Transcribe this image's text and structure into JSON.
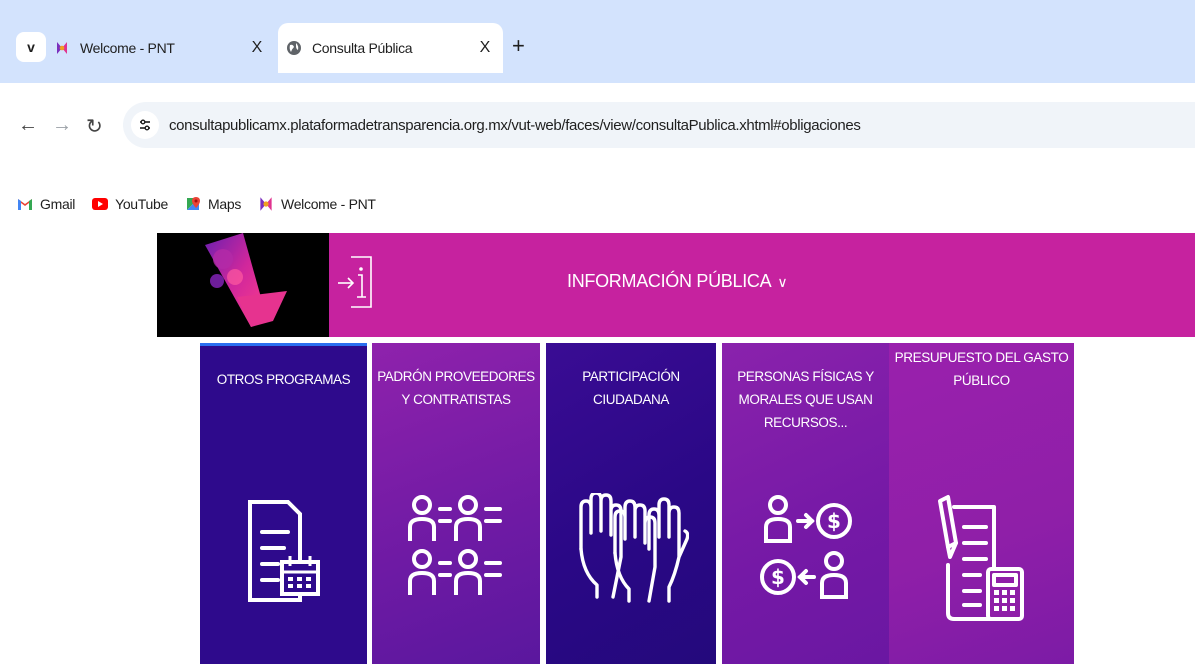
{
  "browser": {
    "tabs": [
      {
        "title": "Welcome - PNT",
        "active": false
      },
      {
        "title": "Consulta Pública",
        "active": true
      }
    ],
    "close_glyph": "X",
    "new_tab_glyph": "+",
    "menu_glyph": "v",
    "url": "consultapublicamx.plataformadetransparencia.org.mx/vut-web/faces/view/consultaPublica.xhtml#obligaciones",
    "bookmarks": [
      {
        "label": "Gmail",
        "icon": "gmail-icon"
      },
      {
        "label": "YouTube",
        "icon": "youtube-icon"
      },
      {
        "label": "Maps",
        "icon": "maps-icon"
      },
      {
        "label": "Welcome - PNT",
        "icon": "pnt-icon"
      }
    ]
  },
  "site": {
    "menu_title": "INFORMACIÓN PÚBLICA",
    "header_color": "#c6229f",
    "tiles": [
      {
        "label": "OTROS PROGRAMAS",
        "icon": "document-calendar-icon",
        "color": "#2e0a8c"
      },
      {
        "label": "PADRÓN PROVEEDORES Y CONTRATISTAS",
        "icon": "people-list-icon",
        "color": "#7a1ca8"
      },
      {
        "label": "PARTICIPACIÓN CIUDADANA",
        "icon": "raised-hands-icon",
        "color": "#2e0a8c"
      },
      {
        "label": "PERSONAS FÍSICAS Y MORALES QUE USAN RECURSOS...",
        "icon": "people-money-exchange-icon",
        "color": "#7a1ca8"
      },
      {
        "label": "PRESUPUESTO DEL GASTO PÚBLICO",
        "icon": "budget-calculator-icon",
        "color": "#8f1fa8"
      }
    ]
  }
}
